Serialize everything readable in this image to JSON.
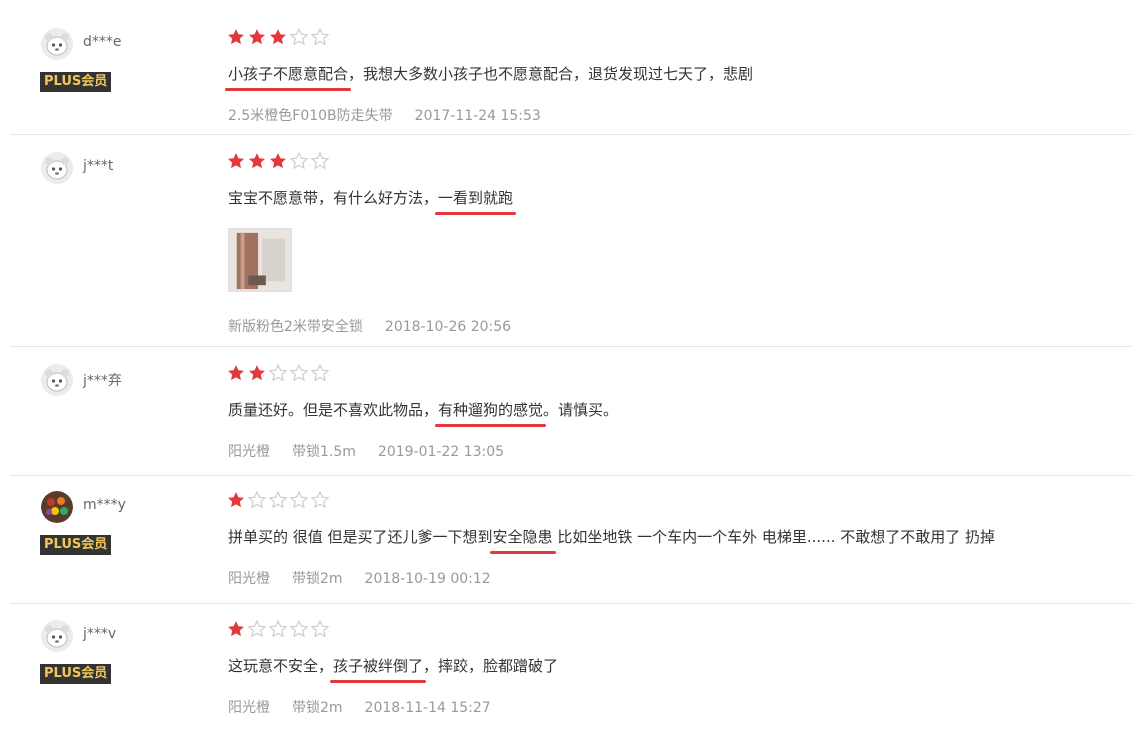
{
  "colors": {
    "star_filled": "#e4393c",
    "star_empty": "#cccccc",
    "highlight_underline": "#e4393c",
    "plus_badge_bg": "#333333",
    "plus_badge_text": "#f0c75b"
  },
  "reviews": [
    {
      "username": "d***e",
      "plus_badge": "PLUS会员",
      "rating": 3,
      "comment": {
        "before": "",
        "highlight": "小孩子不愿意配合",
        "after": "，我想大多数小孩子也不愿意配合，退货发现过七天了，悲剧"
      },
      "tags": [
        "2.5米橙色F010B防走失带"
      ],
      "datetime": "2017-11-24 15:53",
      "avatar_icon": "default-avatar-icon",
      "has_photo": false
    },
    {
      "username": "j***t",
      "plus_badge": "",
      "rating": 3,
      "comment": {
        "before": "宝宝不愿意带，有什么好方法，",
        "highlight": "一看到就跑",
        "after": ""
      },
      "tags": [
        "新版粉色2米带安全锁"
      ],
      "datetime": "2018-10-26 20:56",
      "avatar_icon": "default-avatar-icon",
      "has_photo": true
    },
    {
      "username": "j***弃",
      "plus_badge": "",
      "rating": 2,
      "comment": {
        "before": "质量还好。但是不喜欢此物品，",
        "highlight": "有种遛狗的感觉",
        "after": "。请慎买。"
      },
      "tags": [
        "阳光橙",
        "带锁1.5m"
      ],
      "datetime": "2019-01-22 13:05",
      "avatar_icon": "default-avatar-icon",
      "has_photo": false
    },
    {
      "username": "m***y",
      "plus_badge": "PLUS会员",
      "rating": 1,
      "comment": {
        "before": "拼单买的 很值 但是买了还儿爹一下想到",
        "highlight": "安全隐患",
        "after": " 比如坐地铁 一个车内一个车外 电梯里...... 不敢想了不敢用了 扔掉"
      },
      "tags": [
        "阳光橙",
        "带锁2m"
      ],
      "datetime": "2018-10-19 00:12",
      "avatar_icon": "user-photo-avatar-icon",
      "has_photo": false
    },
    {
      "username": "j***v",
      "plus_badge": "PLUS会员",
      "rating": 1,
      "comment": {
        "before": "这玩意不安全，",
        "highlight": "孩子被绊倒了",
        "after": "，摔跤，脸都蹭破了"
      },
      "tags": [
        "阳光橙",
        "带锁2m"
      ],
      "datetime": "2018-11-14 15:27",
      "avatar_icon": "default-avatar-icon",
      "has_photo": false
    }
  ]
}
